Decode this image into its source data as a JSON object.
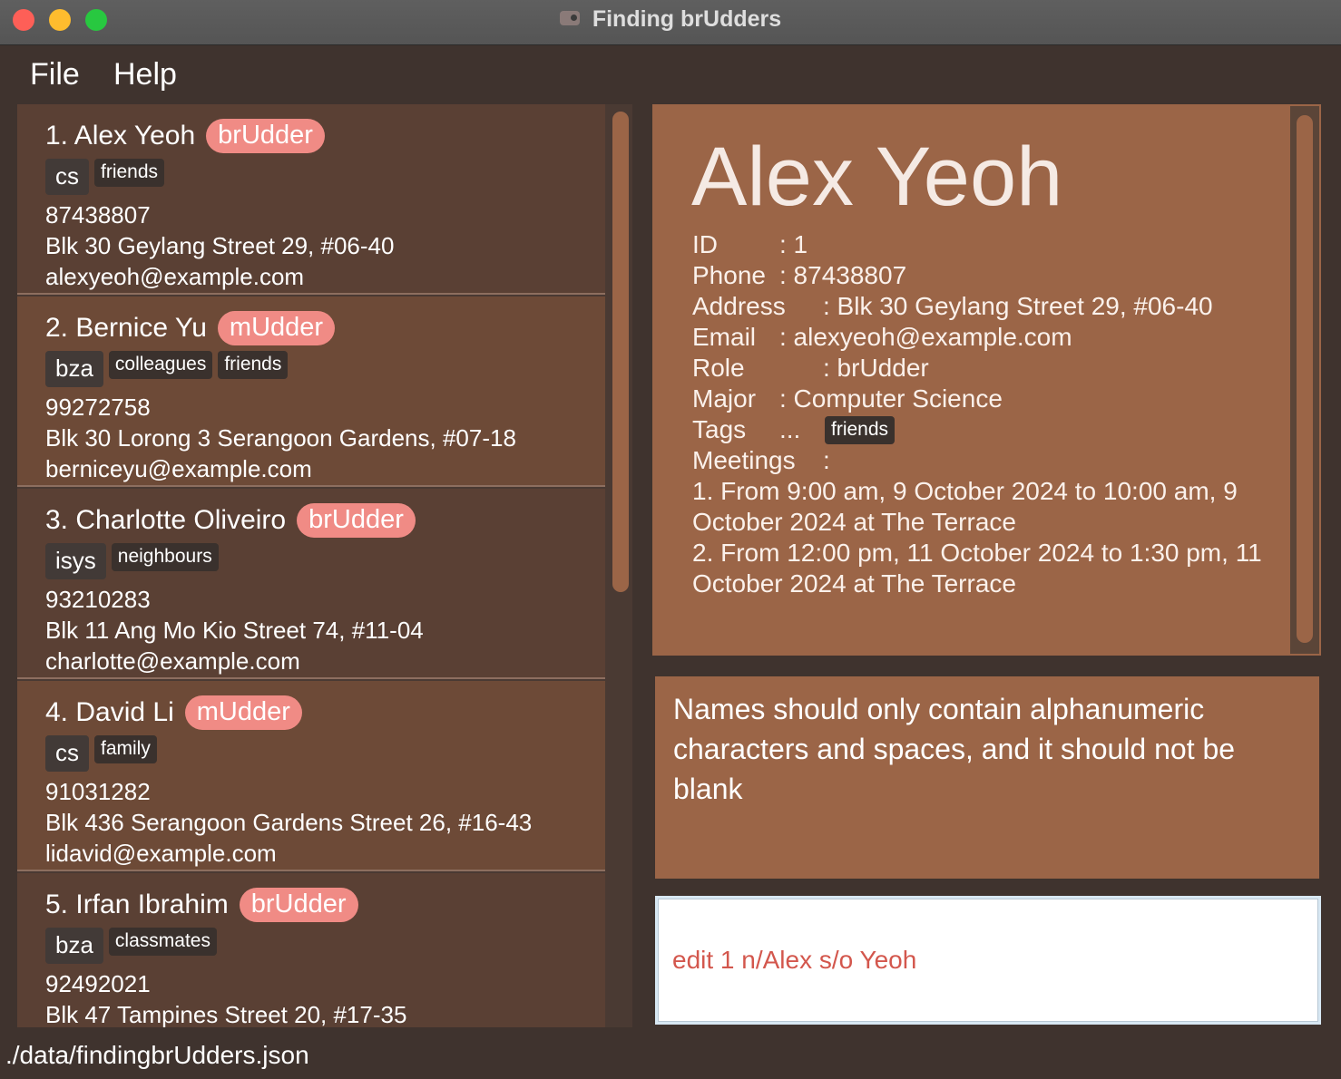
{
  "window": {
    "title": "Finding brUdders"
  },
  "menu": {
    "file": "File",
    "help": "Help"
  },
  "persons": [
    {
      "index_name": "1. Alex Yeoh",
      "role": "brUdder",
      "major_tag": "cs",
      "tags": [
        "friends"
      ],
      "phone": "87438807",
      "address": "Blk 30 Geylang Street 29, #06-40",
      "email": "alexyeoh@example.com"
    },
    {
      "index_name": "2. Bernice Yu",
      "role": "mUdder",
      "major_tag": "bza",
      "tags": [
        "colleagues",
        "friends"
      ],
      "phone": "99272758",
      "address": "Blk 30 Lorong 3 Serangoon Gardens, #07-18",
      "email": "berniceyu@example.com"
    },
    {
      "index_name": "3. Charlotte Oliveiro",
      "role": "brUdder",
      "major_tag": "isys",
      "tags": [
        "neighbours"
      ],
      "phone": "93210283",
      "address": "Blk 11 Ang Mo Kio Street 74, #11-04",
      "email": "charlotte@example.com"
    },
    {
      "index_name": "4. David Li",
      "role": "mUdder",
      "major_tag": "cs",
      "tags": [
        "family"
      ],
      "phone": "91031282",
      "address": "Blk 436 Serangoon Gardens Street 26, #16-43",
      "email": "lidavid@example.com"
    },
    {
      "index_name": "5. Irfan Ibrahim",
      "role": "brUdder",
      "major_tag": "bza",
      "tags": [
        "classmates"
      ],
      "phone": "92492021",
      "address": "Blk 47 Tampines Street 20, #17-35",
      "email": ""
    }
  ],
  "detail": {
    "name": "Alex Yeoh",
    "id_label": "ID",
    "id_value": ": 1",
    "phone_label": "Phone",
    "phone_value": ": 87438807",
    "address_label": "Address",
    "address_value": ": Blk 30 Geylang Street 29, #06-40",
    "email_label": "Email",
    "email_value": ": alexyeoh@example.com",
    "role_label": "Role",
    "role_value": ": brUdder",
    "major_label": "Major",
    "major_value": ": Computer Science",
    "tags_label": "Tags",
    "tags_sep": "...",
    "tags": [
      "friends"
    ],
    "meetings_label": "Meetings",
    "meetings_sep": ":",
    "meetings": [
      "1. From 9:00 am, 9 October 2024 to 10:00 am, 9 October 2024 at The Terrace",
      "2. From 12:00 pm, 11 October 2024 to 1:30 pm, 11 October 2024 at The Terrace"
    ]
  },
  "result": {
    "message": "Names should only contain alphanumeric characters and spaces, and it should not be blank"
  },
  "command": {
    "value": "edit 1 n/Alex s/o Yeoh"
  },
  "status": {
    "path": "./data/findingbrUdders.json"
  },
  "colors": {
    "accent": "#9b6547",
    "role_badge": "#f08b85",
    "command_text": "#d3574d"
  }
}
